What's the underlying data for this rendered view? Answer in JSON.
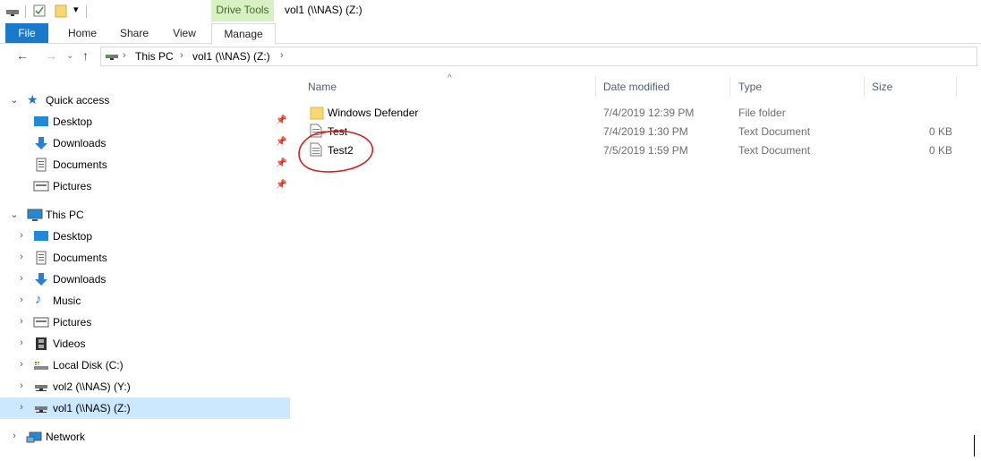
{
  "titlebar": {
    "drive_tools": "Drive Tools",
    "window_title": "vol1 (\\\\NAS) (Z:)",
    "qat_icons": [
      "drive-icon",
      "properties-icon",
      "new-folder-icon",
      "customize-dropdown-icon"
    ]
  },
  "ribbon": {
    "tabs": [
      {
        "label": "File"
      },
      {
        "label": "Home"
      },
      {
        "label": "Share"
      },
      {
        "label": "View"
      },
      {
        "label": "Manage"
      }
    ]
  },
  "address": {
    "icons": [
      "back-arrow-icon",
      "forward-arrow-icon",
      "recent-dropdown-icon",
      "up-arrow-icon"
    ],
    "crumbs": [
      "This PC",
      "vol1 (\\\\NAS) (Z:)"
    ]
  },
  "nav": {
    "quick_access": {
      "label": "Quick access",
      "items": [
        {
          "label": "Desktop",
          "icon": "desktop-icon",
          "pinned": true
        },
        {
          "label": "Downloads",
          "icon": "download-icon",
          "pinned": true
        },
        {
          "label": "Documents",
          "icon": "documents-icon",
          "pinned": true
        },
        {
          "label": "Pictures",
          "icon": "pictures-icon",
          "pinned": true
        }
      ]
    },
    "this_pc": {
      "label": "This PC",
      "items": [
        {
          "label": "Desktop",
          "icon": "desktop-icon"
        },
        {
          "label": "Documents",
          "icon": "documents-icon"
        },
        {
          "label": "Downloads",
          "icon": "download-icon"
        },
        {
          "label": "Music",
          "icon": "music-icon"
        },
        {
          "label": "Pictures",
          "icon": "pictures-icon"
        },
        {
          "label": "Videos",
          "icon": "videos-icon"
        },
        {
          "label": "Local Disk (C:)",
          "icon": "local-disk-icon"
        },
        {
          "label": "vol2 (\\\\NAS) (Y:)",
          "icon": "network-drive-icon"
        },
        {
          "label": "vol1 (\\\\NAS) (Z:)",
          "icon": "network-drive-icon",
          "selected": true
        }
      ]
    },
    "network": {
      "label": "Network",
      "icon": "network-icon"
    }
  },
  "list": {
    "columns": [
      "Name",
      "Date modified",
      "Type",
      "Size"
    ],
    "sort_indicator": "^",
    "files": [
      {
        "name": "Windows Defender",
        "date": "7/4/2019 12:39 PM",
        "type": "File folder",
        "size": "",
        "icon": "folder-icon"
      },
      {
        "name": "Test",
        "date": "7/4/2019 1:30 PM",
        "type": "Text Document",
        "size": "0 KB",
        "icon": "text-file-icon"
      },
      {
        "name": "Test2",
        "date": "7/5/2019 1:59 PM",
        "type": "Text Document",
        "size": "0 KB",
        "icon": "text-file-icon",
        "circled": true
      }
    ]
  },
  "colors": {
    "file_tab": "#1979ca",
    "drive_tools_bg": "#d9efc4",
    "selected_bg": "#cce8ff",
    "annotation": "#d62020",
    "folder": "#f8d775"
  }
}
